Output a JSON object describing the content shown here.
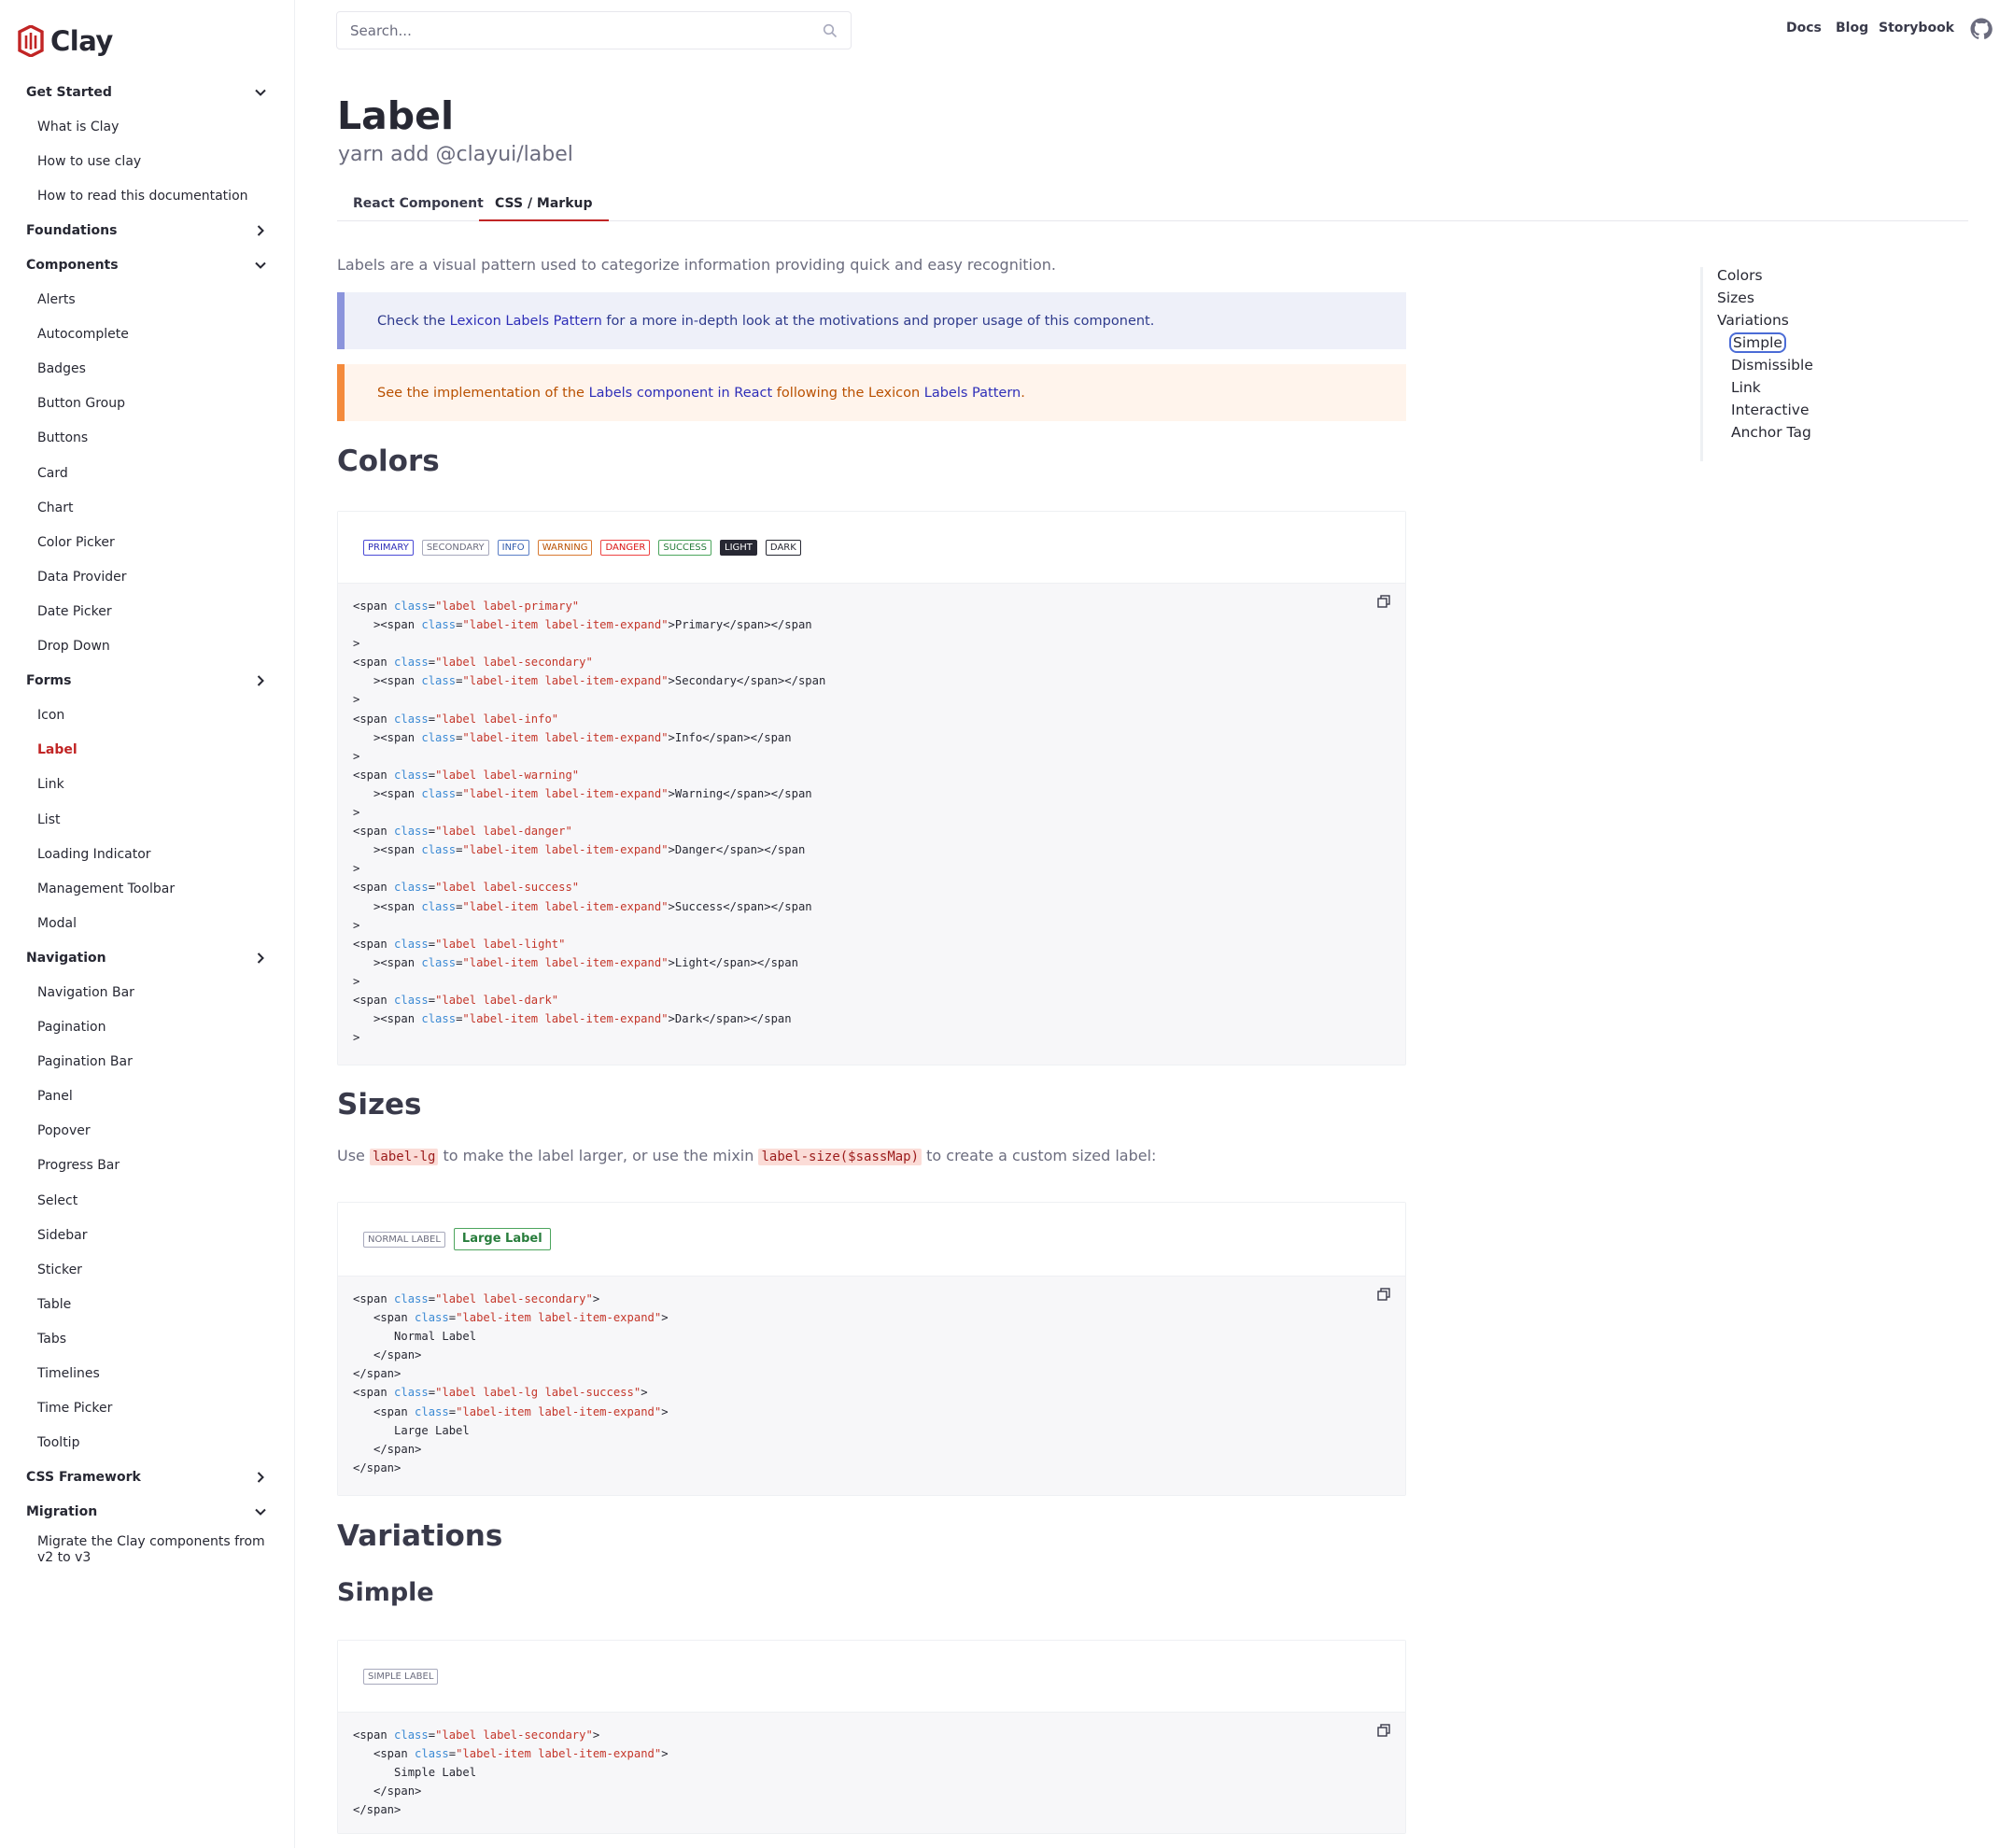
{
  "brand": {
    "name": "Clay",
    "accent": "#c12525"
  },
  "search": {
    "placeholder": "Search..."
  },
  "topnav": {
    "links": [
      "Docs",
      "Blog",
      "Storybook"
    ]
  },
  "sidebar": {
    "items": [
      {
        "label": "Get Started",
        "type": "section",
        "chevron": "down"
      },
      {
        "label": "What is Clay",
        "type": "item"
      },
      {
        "label": "How to use clay",
        "type": "item"
      },
      {
        "label": "How to read this documentation",
        "type": "item"
      },
      {
        "label": "Foundations",
        "type": "section",
        "chevron": "right"
      },
      {
        "label": "Components",
        "type": "section",
        "chevron": "down"
      },
      {
        "label": "Alerts",
        "type": "item"
      },
      {
        "label": "Autocomplete",
        "type": "item"
      },
      {
        "label": "Badges",
        "type": "item"
      },
      {
        "label": "Button Group",
        "type": "item"
      },
      {
        "label": "Buttons",
        "type": "item"
      },
      {
        "label": "Card",
        "type": "item"
      },
      {
        "label": "Chart",
        "type": "item"
      },
      {
        "label": "Color Picker",
        "type": "item"
      },
      {
        "label": "Data Provider",
        "type": "item"
      },
      {
        "label": "Date Picker",
        "type": "item"
      },
      {
        "label": "Drop Down",
        "type": "item"
      },
      {
        "label": "Forms",
        "type": "section",
        "chevron": "right"
      },
      {
        "label": "Icon",
        "type": "item"
      },
      {
        "label": "Label",
        "type": "item",
        "active": true
      },
      {
        "label": "Link",
        "type": "item"
      },
      {
        "label": "List",
        "type": "item"
      },
      {
        "label": "Loading Indicator",
        "type": "item"
      },
      {
        "label": "Management Toolbar",
        "type": "item"
      },
      {
        "label": "Modal",
        "type": "item"
      },
      {
        "label": "Navigation",
        "type": "section",
        "chevron": "right"
      },
      {
        "label": "Navigation Bar",
        "type": "item"
      },
      {
        "label": "Pagination",
        "type": "item"
      },
      {
        "label": "Pagination Bar",
        "type": "item"
      },
      {
        "label": "Panel",
        "type": "item"
      },
      {
        "label": "Popover",
        "type": "item"
      },
      {
        "label": "Progress Bar",
        "type": "item"
      },
      {
        "label": "Select",
        "type": "item"
      },
      {
        "label": "Sidebar",
        "type": "item"
      },
      {
        "label": "Sticker",
        "type": "item"
      },
      {
        "label": "Table",
        "type": "item"
      },
      {
        "label": "Tabs",
        "type": "item"
      },
      {
        "label": "Timelines",
        "type": "item"
      },
      {
        "label": "Time Picker",
        "type": "item"
      },
      {
        "label": "Tooltip",
        "type": "item"
      },
      {
        "label": "CSS Framework",
        "type": "section",
        "chevron": "right"
      },
      {
        "label": "Migration",
        "type": "section",
        "chevron": "down"
      },
      {
        "label": "Migrate the Clay components from v2 to v3",
        "type": "item",
        "wrap": true
      }
    ]
  },
  "page": {
    "title": "Label",
    "install": "yarn add @clayui/label",
    "tabs": [
      {
        "label": "React Component",
        "active": false
      },
      {
        "label": "CSS / Markup",
        "active": true
      }
    ],
    "lead": "Labels are a visual pattern used to categorize information providing quick and easy recognition.",
    "alert_info": {
      "pre": "Check the ",
      "link": "Lexicon Labels Pattern",
      "post": " for a more in-depth look at the motivations and proper usage of this component."
    },
    "alert_warning": {
      "pre": "See the implementation of the ",
      "link1": "Labels component in React",
      "mid": " following the Lexicon ",
      "link2": "Labels Pattern",
      "post": "."
    },
    "colors": {
      "heading": "Colors",
      "labels": [
        {
          "text": "PRIMARY",
          "variant": "primary"
        },
        {
          "text": "SECONDARY",
          "variant": "secondary"
        },
        {
          "text": "INFO",
          "variant": "info"
        },
        {
          "text": "WARNING",
          "variant": "warning"
        },
        {
          "text": "DANGER",
          "variant": "danger"
        },
        {
          "text": "SUCCESS",
          "variant": "success"
        },
        {
          "text": "LIGHT",
          "variant": "light"
        },
        {
          "text": "DARK",
          "variant": "dark"
        }
      ],
      "code": [
        {
          "cls": "label label-primary",
          "text": "Primary",
          "wrap": false
        },
        {
          "cls": "label label-secondary",
          "text": "Secondary",
          "wrap": true
        },
        {
          "cls": "label label-info",
          "text": "Info",
          "wrap": false
        },
        {
          "cls": "label label-warning",
          "text": "Warning",
          "wrap": false
        },
        {
          "cls": "label label-danger",
          "text": "Danger",
          "wrap": true
        },
        {
          "cls": "label label-success",
          "text": "Success",
          "wrap": false
        },
        {
          "cls": "label label-light",
          "text": "Light",
          "wrap": true
        },
        {
          "cls": "label label-dark",
          "text": "Dark",
          "wrap": false
        }
      ],
      "item_cls": "label-item label-item-expand"
    },
    "sizes": {
      "heading": "Sizes",
      "text_pre": "Use ",
      "code1": "label-lg",
      "text_mid": " to make the label larger, or use the mixin ",
      "code2": "label-size($sassMap)",
      "text_post": " to create a custom sized label:",
      "normal_label": "NORMAL LABEL",
      "large_label": "Large Label",
      "code_normal_cls": "label label-secondary",
      "code_large_cls": "label label-lg label-success",
      "code_normal_text": "Normal Label",
      "code_large_text": "Large Label"
    },
    "variations": {
      "heading": "Variations"
    },
    "simple": {
      "heading": "Simple",
      "label": "SIMPLE LABEL",
      "code_cls": "label label-secondary",
      "code_text": "Simple Label"
    }
  },
  "toc": {
    "items": [
      {
        "label": "Colors",
        "level": 1
      },
      {
        "label": "Sizes",
        "level": 1
      },
      {
        "label": "Variations",
        "level": 1
      },
      {
        "label": "Simple",
        "level": 2,
        "active": true
      },
      {
        "label": "Dismissible",
        "level": 2
      },
      {
        "label": "Link",
        "level": 2
      },
      {
        "label": "Interactive",
        "level": 2
      },
      {
        "label": "Anchor Tag",
        "level": 2
      }
    ]
  }
}
